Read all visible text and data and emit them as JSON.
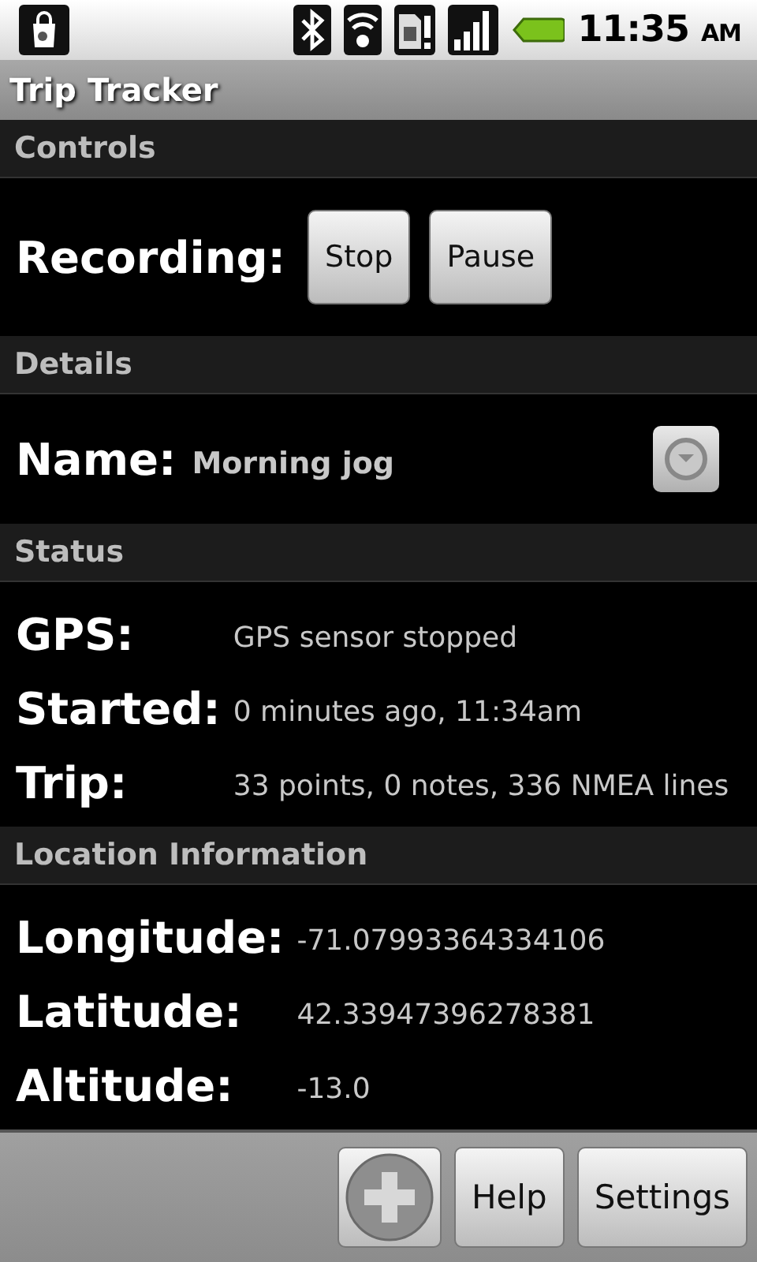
{
  "status_bar": {
    "time": "11:35",
    "meridiem": "AM"
  },
  "app_title": "Trip Tracker",
  "sections": [
    {
      "title": "Controls",
      "kind": "controls",
      "label": "Recording:",
      "buttons": [
        "Stop",
        "Pause"
      ]
    },
    {
      "title": "Details",
      "kind": "name",
      "label": "Name:",
      "value": "Morning jog"
    },
    {
      "title": "Status",
      "kind": "fields",
      "rows": [
        {
          "label": "GPS:",
          "value": "GPS sensor stopped"
        },
        {
          "label": "Started:",
          "value": "0 minutes ago, 11:34am"
        },
        {
          "label": "Trip:",
          "value": "33 points, 0 notes, 336 NMEA lines"
        }
      ]
    },
    {
      "title": "Location Information",
      "kind": "fields",
      "rows": [
        {
          "label": "Longitude:",
          "value": "-71.07993364334106"
        },
        {
          "label": "Latitude:",
          "value": "42.33947396278381"
        },
        {
          "label": "Altitude:",
          "value": "-13.0"
        }
      ]
    }
  ],
  "bottom_buttons": [
    {
      "kind": "add"
    },
    {
      "kind": "text",
      "label": "Help"
    },
    {
      "kind": "text",
      "label": "Settings"
    }
  ]
}
